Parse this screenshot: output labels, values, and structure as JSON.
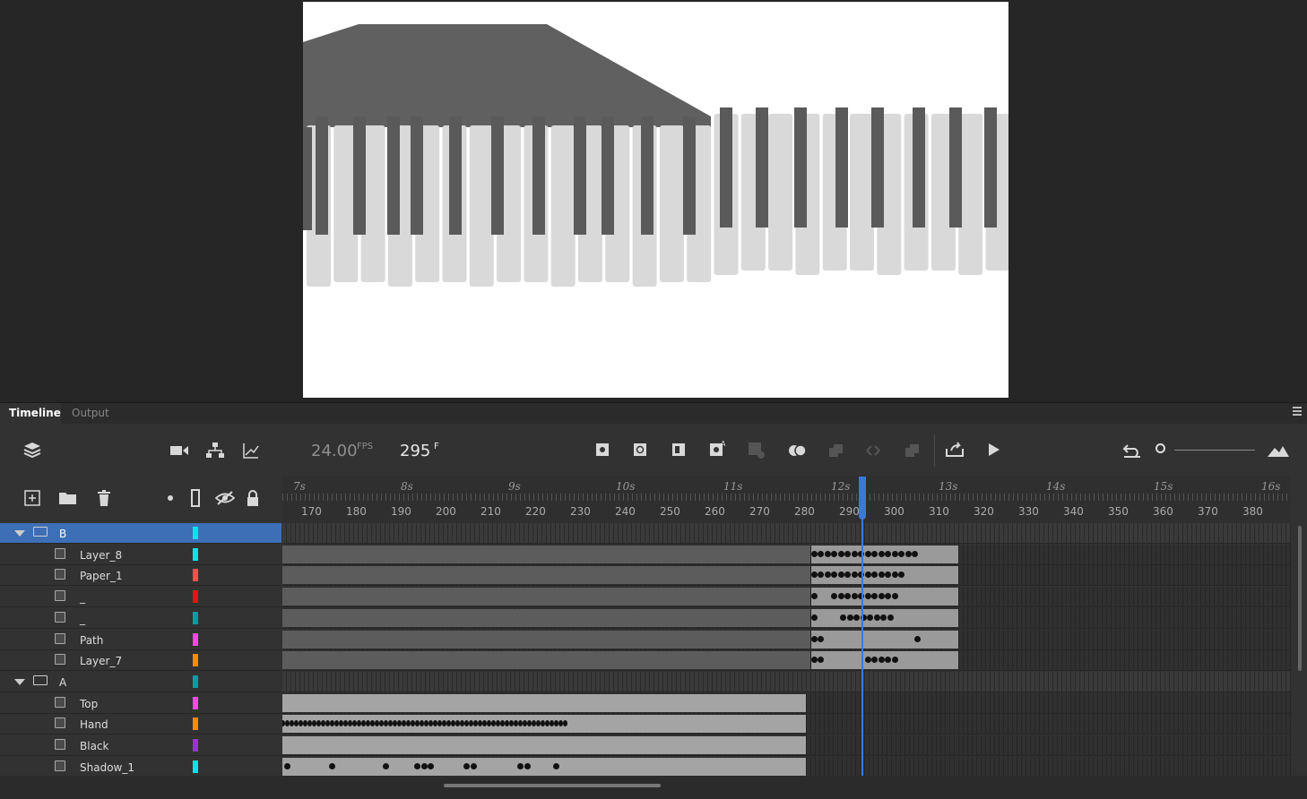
{
  "panel": {
    "tabs": [
      {
        "label": "Timeline",
        "active": true
      },
      {
        "label": "Output",
        "active": false
      }
    ]
  },
  "toolbar": {
    "fps": "24.00",
    "fps_unit": "FPS",
    "frame": "295",
    "frame_unit": "F"
  },
  "ruler": {
    "seconds": [
      "7s",
      "8s",
      "9s",
      "10s",
      "11s",
      "12s",
      "13s",
      "14s",
      "15s",
      "16s"
    ],
    "frames": [
      "170",
      "180",
      "190",
      "200",
      "210",
      "220",
      "230",
      "240",
      "250",
      "260",
      "270",
      "280",
      "290",
      "300",
      "310",
      "320",
      "330",
      "340",
      "350",
      "360",
      "370",
      "380"
    ]
  },
  "layers": [
    {
      "name": "B",
      "type": "folder",
      "color": "#00e5ee",
      "selected": true
    },
    {
      "name": "Layer_8",
      "type": "layer",
      "color": "#00e5ee"
    },
    {
      "name": "Paper_1",
      "type": "layer",
      "color": "#ff4d4d"
    },
    {
      "name": "_",
      "type": "layer",
      "color": "#ee1111"
    },
    {
      "name": "_",
      "type": "layer",
      "color": "#00a0a0"
    },
    {
      "name": "Path",
      "type": "layer",
      "color": "#ff44ee"
    },
    {
      "name": "Layer_7",
      "type": "layer",
      "color": "#ff8a00"
    },
    {
      "name": "A",
      "type": "folder",
      "color": "#00a0a0"
    },
    {
      "name": "Top",
      "type": "layer",
      "color": "#ff44ee"
    },
    {
      "name": "Hand",
      "type": "layer",
      "color": "#ff8a00"
    },
    {
      "name": "Black",
      "type": "layer",
      "color": "#9b30d9"
    },
    {
      "name": "Shadow_1",
      "type": "layer",
      "color": "#00e5ee"
    }
  ],
  "colors": {
    "accent": "#3b78d8",
    "selection": "#3d6fb6"
  }
}
